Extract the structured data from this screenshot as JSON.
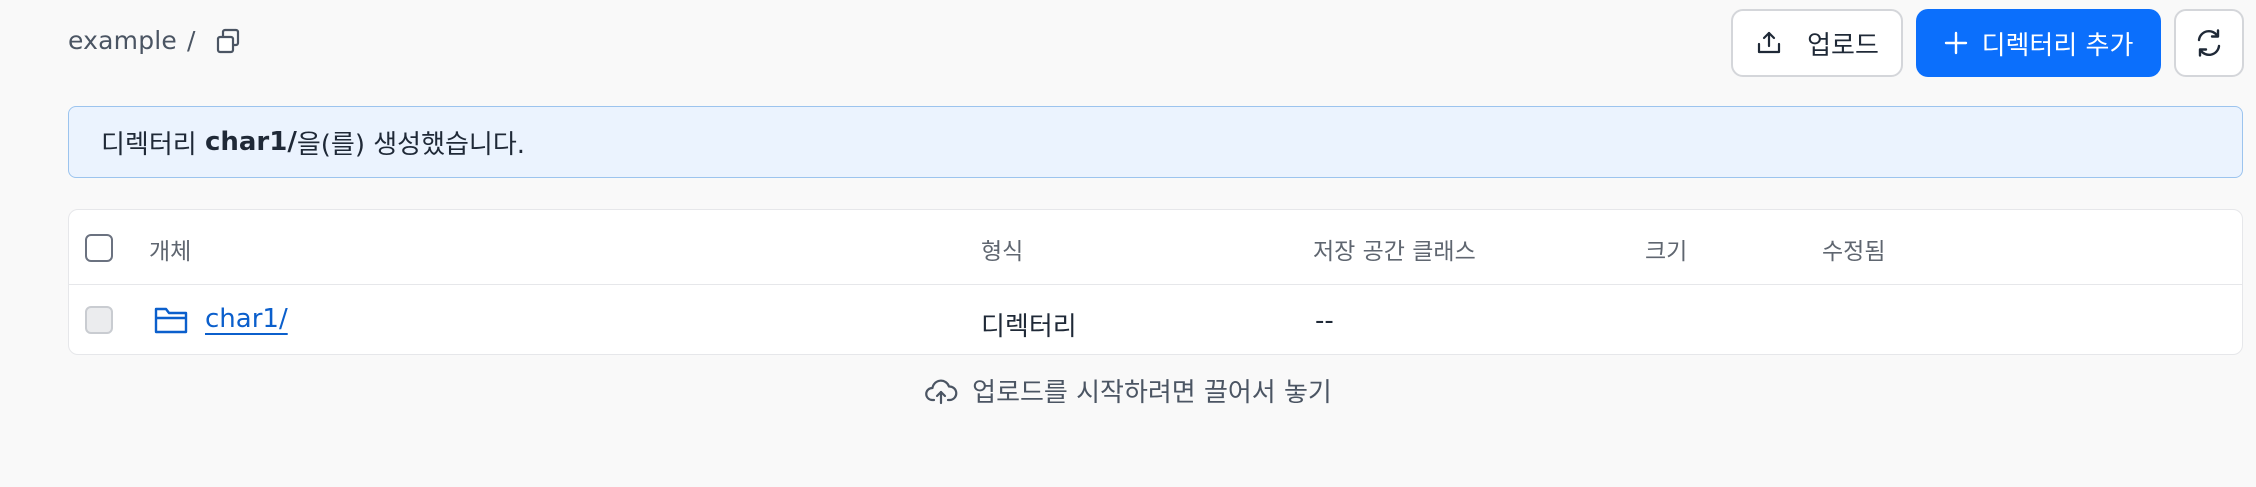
{
  "breadcrumb": {
    "bucket": "example",
    "separator": "/"
  },
  "toolbar": {
    "upload_label": "업로드",
    "add_directory_label": "디렉터리 추가"
  },
  "alert": {
    "prefix": "디렉터리 ",
    "name": "char1/",
    "suffix": "을(를) 생성했습니다."
  },
  "table": {
    "columns": [
      "개체",
      "형식",
      "저장 공간 클래스",
      "크기",
      "수정됨"
    ],
    "rows": [
      {
        "name": "char1/",
        "type": "디렉터리",
        "storage_class": "--",
        "size": "",
        "modified": ""
      }
    ]
  },
  "dropzone": {
    "text": "업로드를 시작하려면 끌어서 놓기"
  },
  "colors": {
    "accent": "#0b6ffc",
    "link": "#0b5fcc",
    "alert_bg": "#ebf3fe",
    "alert_border": "#9cc4ee"
  },
  "icons": [
    "copy-icon",
    "upload-icon",
    "plus-icon",
    "refresh-icon",
    "folder-icon",
    "cloud-upload-icon"
  ]
}
